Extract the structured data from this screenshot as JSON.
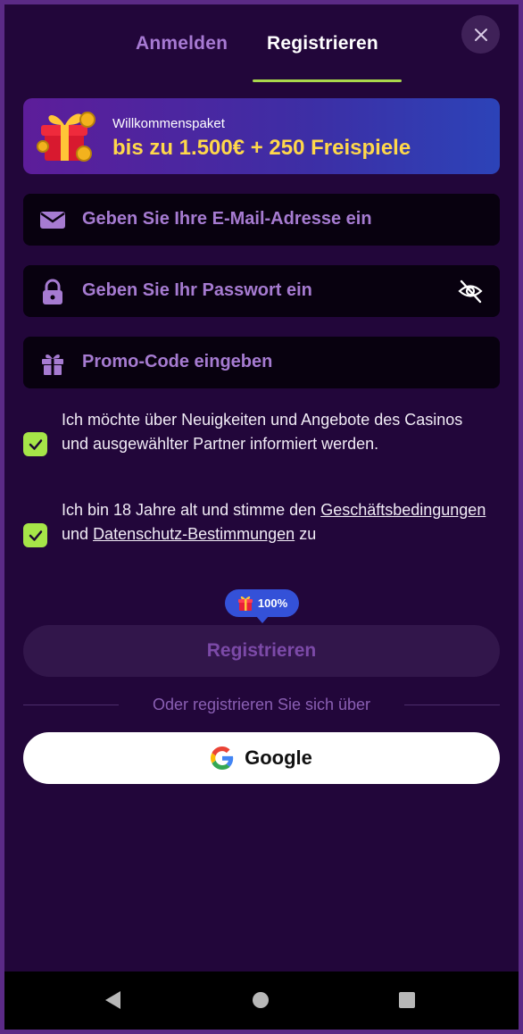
{
  "tabs": {
    "login": "Anmelden",
    "register": "Registrieren"
  },
  "banner": {
    "subtitle": "Willkommenspaket",
    "headline": "bis zu 1.500€ + 250 Freispiele"
  },
  "fields": {
    "email_placeholder": "Geben Sie Ihre E-Mail-Adresse ein",
    "password_placeholder": "Geben Sie Ihr Passwort ein",
    "promo_placeholder": "Promo-Code eingeben"
  },
  "consents": {
    "newsletter": "Ich möchte über Neuigkeiten und Angebote des Casinos und ausgewählter Partner informiert werden.",
    "age_prefix": "Ich bin 18 Jahre alt und stimme den",
    "terms_link": "Geschäftsbedingungen",
    "age_and": "und",
    "privacy_link": "Datenschutz-Bestimmungen",
    "age_suffix": "zu"
  },
  "bonus": {
    "percent": "100%"
  },
  "actions": {
    "register_label": "Registrieren",
    "divider_text": "Oder registrieren Sie sich über",
    "google_label": "Google"
  },
  "colors": {
    "background": "#22063a",
    "accent_green": "#a6e548",
    "tab_inactive": "#a77ad3",
    "headline_yellow": "#ffd84a",
    "pill_blue": "#3451d8"
  }
}
